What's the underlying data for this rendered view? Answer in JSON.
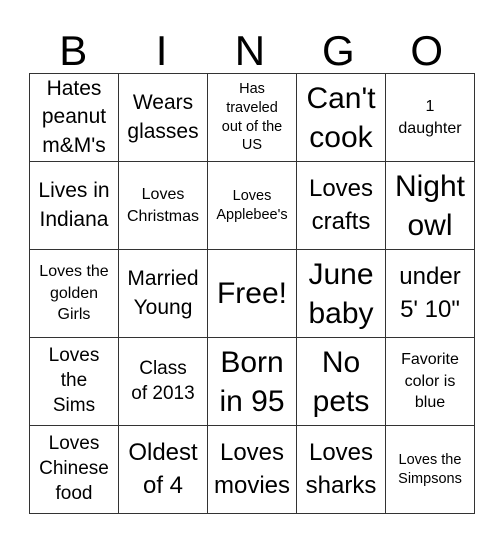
{
  "header": {
    "letters": [
      "B",
      "I",
      "N",
      "G",
      "O"
    ]
  },
  "grid": {
    "rows": [
      [
        "Hates\npeanut\nm&M's",
        "Wears\nglasses",
        "Has\ntraveled\nout of the\nUS",
        "Can't\ncook",
        "1\ndaughter"
      ],
      [
        "Lives in\nIndiana",
        "Loves\nChristmas",
        "Loves\nApplebee's",
        "Loves\ncrafts",
        "Night\nowl"
      ],
      [
        "Loves the\ngolden\nGirls",
        "Married\nYoung",
        "Free!",
        "June\nbaby",
        "under\n5' 10\""
      ],
      [
        "Loves\nthe\nSims",
        "Class\nof 2013",
        "Born\nin 95",
        "No\npets",
        "Favorite\ncolor is\nblue"
      ],
      [
        "Loves\nChinese\nfood",
        "Oldest\nof 4",
        "Loves\nmovies",
        "Loves\nsharks",
        "Loves the\nSimpsons"
      ]
    ]
  }
}
